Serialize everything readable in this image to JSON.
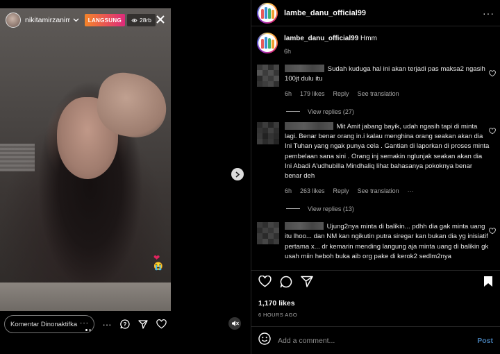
{
  "live": {
    "username": "nikitamirzanim...",
    "badge": "LANGSUNG",
    "viewers": "28rb",
    "comment_placeholder": "Komentar Dinonaktifka"
  },
  "post": {
    "username": "lambe_danu_official99",
    "caption_text": "Hmm",
    "caption_time": "6h",
    "comments": [
      {
        "text": "Sudah kuduga hal ini akan terjadi pas maksa2 ngasih 100jt dulu itu",
        "time": "6h",
        "likes": "179 likes",
        "reply": "Reply",
        "translate": "See translation",
        "view_replies": "View replies (27)"
      },
      {
        "text": "Mit Amit jabang bayik, udah ngasih tapi di minta lagi. Benar benar orang in.i kalau menghina orang seakan akan dia Ini Tuhan yang ngak punya cela . Gantian di laporkan di proses minta pembelaan sana sini . Orang inj semakin nglunjak seakan akan dia Ini Abadi A'udhubilla Mindhaliq lihat bahasanya pokoknya benar benar deh",
        "time": "6h",
        "likes": "263 likes",
        "reply": "Reply",
        "translate": "See translation",
        "more": "···",
        "view_replies": "View replies (13)"
      },
      {
        "text": "Ujung2nya minta di balikin... pdhh dia gak minta uang itu lhoo... dan NM kan ngikutin putra siregar kan bukan dia yg inisiatif pertama x... dr kemarin mending langung aja minta uang di balikin gk usah miin heboh buka aib org pake di kerok2 sedlm2nya"
      }
    ],
    "likes_count": "1,170 likes",
    "date": "6 HOURS AGO",
    "add_comment_placeholder": "Add a comment...",
    "post_button": "Post"
  },
  "colors": {
    "background": "#000000",
    "secondary_text": "#a8a8a8",
    "link_blue": "#5aa3e8",
    "live_gradient_start": "#f58529",
    "live_gradient_end": "#dd2a7b"
  },
  "icons": {
    "caption_header": "more-horizontal-icon",
    "live_close": "close-icon",
    "live_next": "chevron-right-icon",
    "live_mute": "speaker-muted-icon",
    "actions": [
      "heart-icon",
      "comment-icon",
      "share-icon",
      "bookmark-icon"
    ],
    "composer": "emoji-icon"
  }
}
